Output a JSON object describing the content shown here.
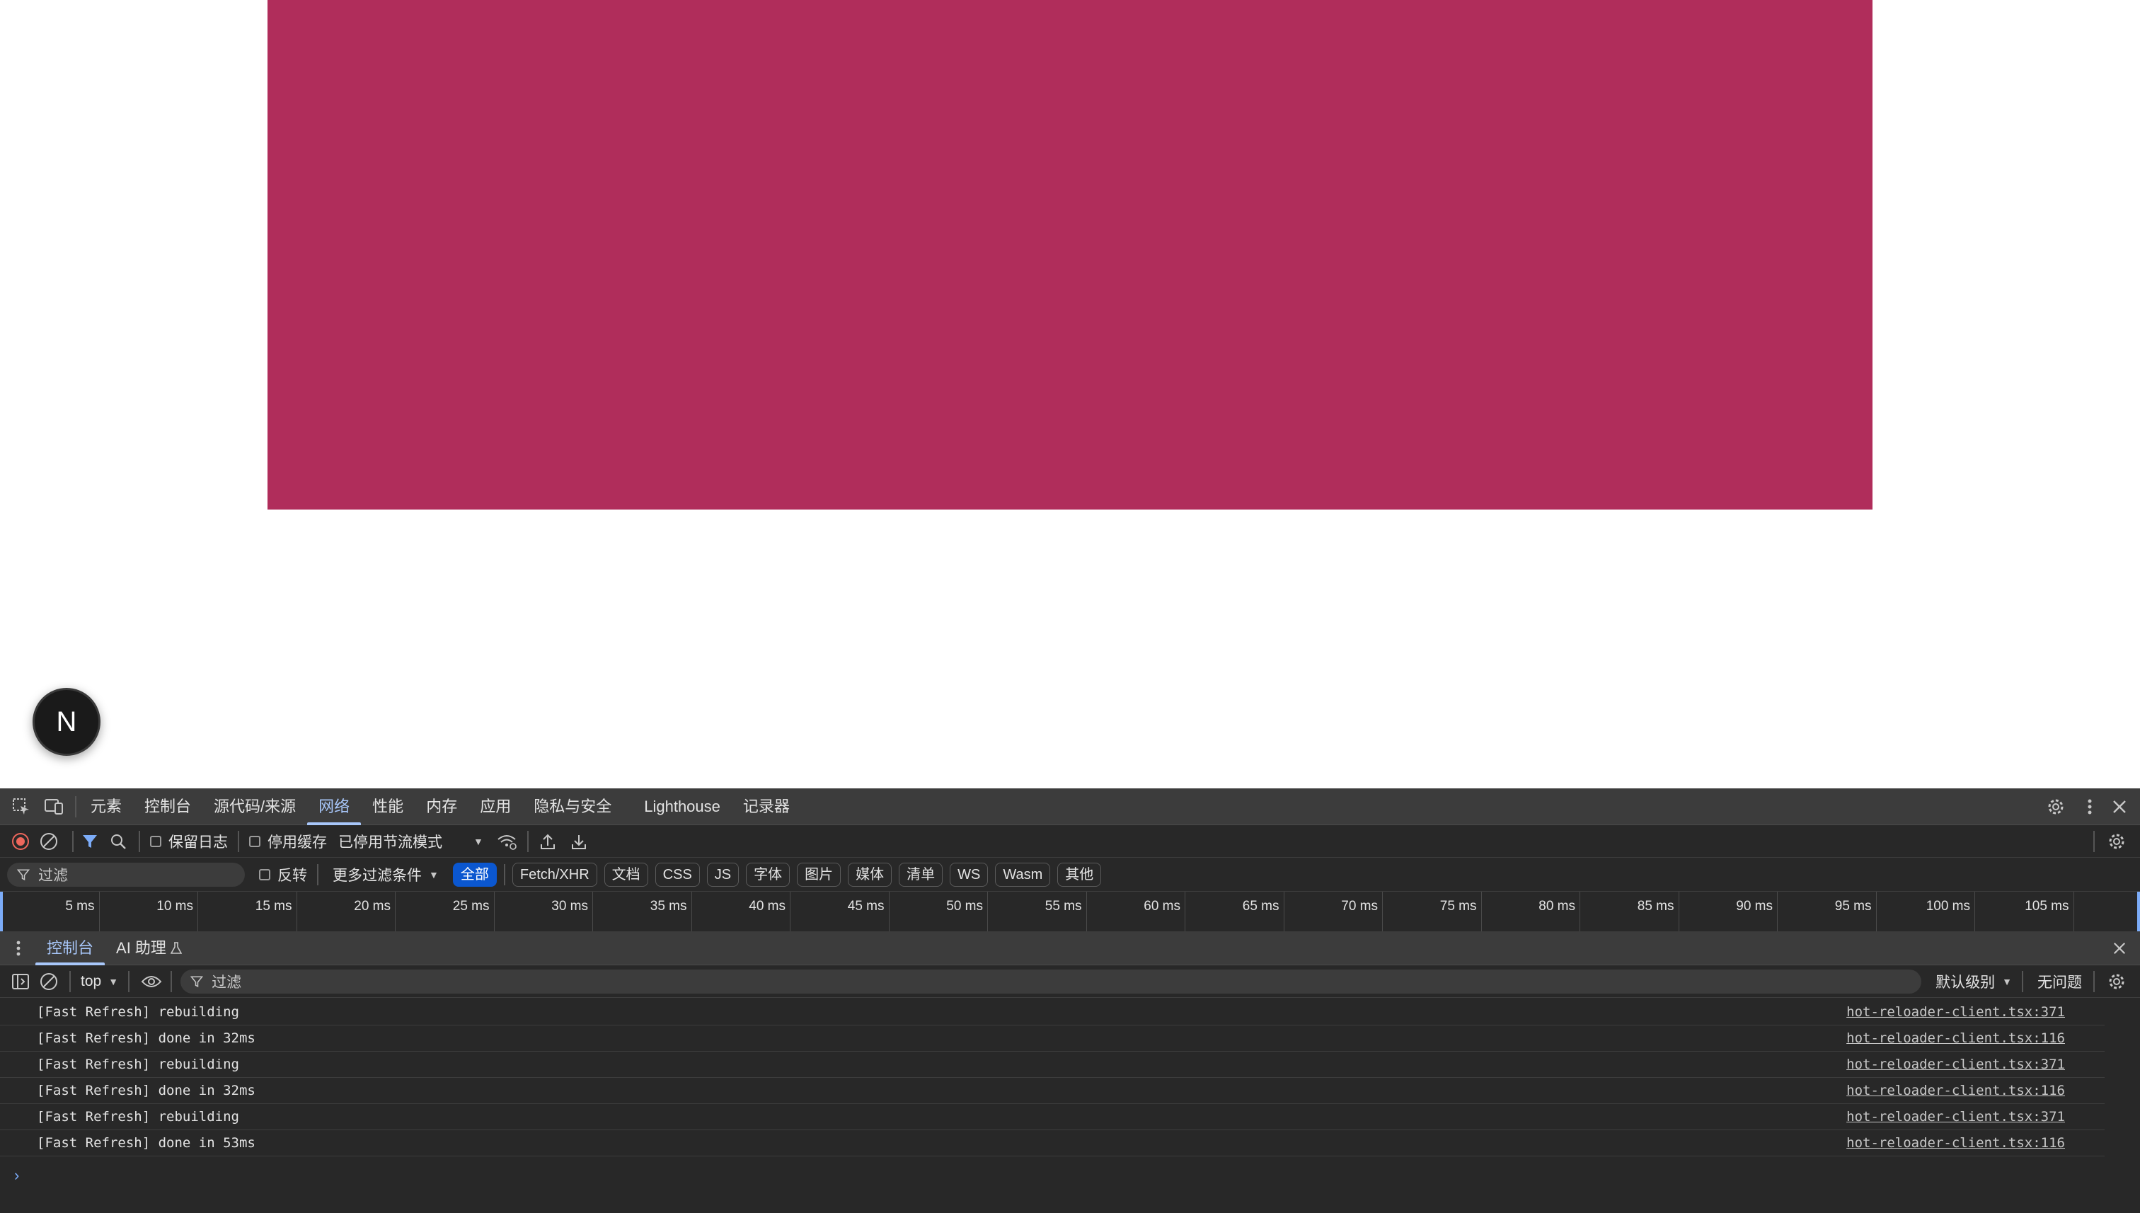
{
  "page": {
    "hero_color": "#b02d5b",
    "badge_letter": "N"
  },
  "devtools": {
    "tabs": [
      "元素",
      "控制台",
      "源代码/来源",
      "网络",
      "性能",
      "内存",
      "应用",
      "隐私与安全",
      "Lighthouse",
      "记录器"
    ],
    "active_tab": "网络",
    "network_toolbar": {
      "preserve_log": "保留日志",
      "disable_cache": "停用缓存",
      "throttling": "已停用节流模式"
    },
    "filter_bar": {
      "placeholder": "过滤",
      "invert": "反转",
      "more_filters": "更多过滤条件",
      "types": [
        "全部",
        "Fetch/XHR",
        "文档",
        "CSS",
        "JS",
        "字体",
        "图片",
        "媒体",
        "清单",
        "WS",
        "Wasm",
        "其他"
      ],
      "active_type": "全部"
    },
    "timeline_ticks": [
      "5 ms",
      "10 ms",
      "15 ms",
      "20 ms",
      "25 ms",
      "30 ms",
      "35 ms",
      "40 ms",
      "45 ms",
      "50 ms",
      "55 ms",
      "60 ms",
      "65 ms",
      "70 ms",
      "75 ms",
      "80 ms",
      "85 ms",
      "90 ms",
      "95 ms",
      "100 ms",
      "105 ms"
    ],
    "drawer": {
      "tabs": [
        "控制台",
        "AI 助理"
      ],
      "active_tab": "控制台"
    },
    "console": {
      "context": "top",
      "filter_placeholder": "过滤",
      "level": "默认级别",
      "issues": "无问题",
      "messages": [
        {
          "text": "[Fast Refresh] rebuilding",
          "source": "hot-reloader-client.tsx:371"
        },
        {
          "text": "[Fast Refresh] done in 32ms",
          "source": "hot-reloader-client.tsx:116"
        },
        {
          "text": "[Fast Refresh] rebuilding",
          "source": "hot-reloader-client.tsx:371"
        },
        {
          "text": "[Fast Refresh] done in 32ms",
          "source": "hot-reloader-client.tsx:116"
        },
        {
          "text": "[Fast Refresh] rebuilding",
          "source": "hot-reloader-client.tsx:371"
        },
        {
          "text": "[Fast Refresh] done in 53ms",
          "source": "hot-reloader-client.tsx:116"
        }
      ]
    },
    "colors": {
      "accent": "#a8c7fa",
      "active_pill": "#0b57d0",
      "record": "#ee675c"
    }
  }
}
